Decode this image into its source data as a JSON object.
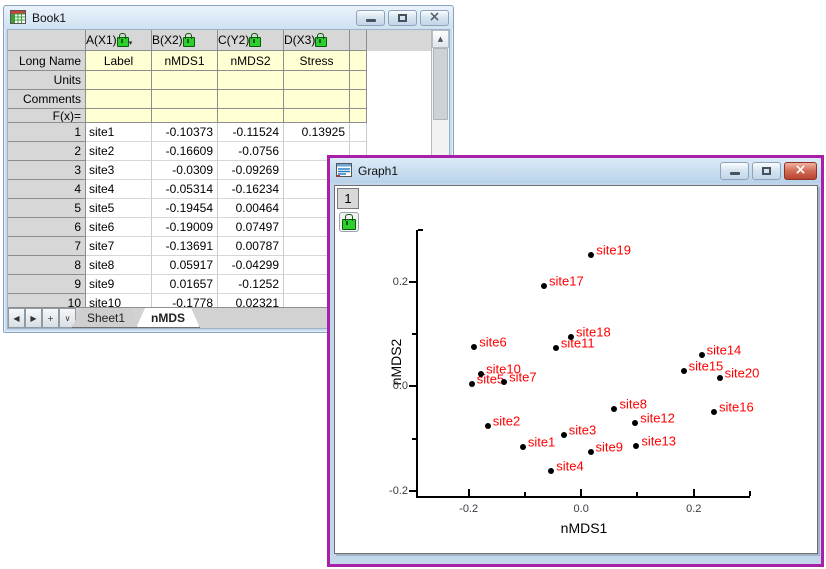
{
  "icons": {
    "close_glyph": "×",
    "scroll_up_glyph": "▲",
    "tab_nav_glyphs": [
      "◀",
      "▶",
      "+",
      "∨"
    ],
    "column_dropdown_glyph": "▾"
  },
  "book_window": {
    "title": "Book1",
    "column_headers": [
      "A(X1)",
      "B(X2)",
      "C(Y2)",
      "D(X3)"
    ],
    "header_rows": [
      {
        "label": "Long Name",
        "cells": [
          "Label",
          "nMDS1",
          "nMDS2",
          "Stress"
        ]
      },
      {
        "label": "Units",
        "cells": [
          "",
          "",
          "",
          ""
        ]
      },
      {
        "label": "Comments",
        "cells": [
          "",
          "",
          "",
          ""
        ]
      },
      {
        "label": "F(x)=",
        "cells": [
          "",
          "",
          "",
          ""
        ]
      }
    ],
    "rows": [
      {
        "n": "1",
        "cells": [
          "site1",
          "-0.10373",
          "-0.11524",
          "0.13925"
        ]
      },
      {
        "n": "2",
        "cells": [
          "site2",
          "-0.16609",
          "-0.0756",
          ""
        ]
      },
      {
        "n": "3",
        "cells": [
          "site3",
          "-0.0309",
          "-0.09269",
          ""
        ]
      },
      {
        "n": "4",
        "cells": [
          "site4",
          "-0.05314",
          "-0.16234",
          ""
        ]
      },
      {
        "n": "5",
        "cells": [
          "site5",
          "-0.19454",
          "0.00464",
          ""
        ]
      },
      {
        "n": "6",
        "cells": [
          "site6",
          "-0.19009",
          "0.07497",
          ""
        ]
      },
      {
        "n": "7",
        "cells": [
          "site7",
          "-0.13691",
          "0.00787",
          ""
        ]
      },
      {
        "n": "8",
        "cells": [
          "site8",
          "0.05917",
          "-0.04299",
          ""
        ]
      },
      {
        "n": "9",
        "cells": [
          "site9",
          "0.01657",
          "-0.1252",
          ""
        ]
      },
      {
        "n": "10",
        "cells": [
          "site10",
          "-0.1778",
          "0.02321",
          ""
        ]
      }
    ],
    "tabs": [
      {
        "label": "Sheet1",
        "active": false
      },
      {
        "label": "nMDS",
        "active": true
      }
    ]
  },
  "graph_window": {
    "title": "Graph1",
    "layer_badge": "1"
  },
  "chart_data": {
    "type": "scatter",
    "title": "",
    "xlabel": "nMDS1",
    "ylabel": "nMDS2",
    "xlim": [
      -0.29,
      0.3
    ],
    "ylim": [
      -0.21,
      0.3
    ],
    "grid": false,
    "legend": "none",
    "point_color": "#000000",
    "label_color": "#ff0000",
    "xticks": {
      "major": [
        -0.2,
        0.0,
        0.2
      ],
      "minor": [
        -0.1,
        0.1
      ],
      "labels": [
        "-0.2",
        "0.0",
        "0.2"
      ]
    },
    "yticks": {
      "major": [
        -0.2,
        0.0,
        0.2
      ],
      "minor": [
        -0.1,
        0.1
      ],
      "labels": [
        "-0.2",
        "0.0",
        "0.2"
      ]
    },
    "points": [
      {
        "label": "site1",
        "x": -0.10373,
        "y": -0.11524
      },
      {
        "label": "site2",
        "x": -0.16609,
        "y": -0.0756
      },
      {
        "label": "site3",
        "x": -0.0309,
        "y": -0.09269
      },
      {
        "label": "site4",
        "x": -0.05314,
        "y": -0.16234
      },
      {
        "label": "site5",
        "x": -0.19454,
        "y": 0.00464
      },
      {
        "label": "site6",
        "x": -0.19009,
        "y": 0.07497
      },
      {
        "label": "site7",
        "x": -0.13691,
        "y": 0.00787
      },
      {
        "label": "site8",
        "x": 0.05917,
        "y": -0.04299
      },
      {
        "label": "site9",
        "x": 0.01657,
        "y": -0.1252
      },
      {
        "label": "site10",
        "x": -0.1778,
        "y": 0.02321
      },
      {
        "label": "site11",
        "x": -0.045,
        "y": 0.074
      },
      {
        "label": "site12",
        "x": 0.096,
        "y": -0.07
      },
      {
        "label": "site13",
        "x": 0.098,
        "y": -0.114
      },
      {
        "label": "site14",
        "x": 0.214,
        "y": 0.061
      },
      {
        "label": "site15",
        "x": 0.182,
        "y": 0.029
      },
      {
        "label": "site16",
        "x": 0.236,
        "y": -0.049
      },
      {
        "label": "site17",
        "x": -0.066,
        "y": 0.192
      },
      {
        "label": "site18",
        "x": -0.018,
        "y": 0.095
      },
      {
        "label": "site19",
        "x": 0.018,
        "y": 0.253
      },
      {
        "label": "site20",
        "x": 0.246,
        "y": 0.017
      }
    ]
  }
}
